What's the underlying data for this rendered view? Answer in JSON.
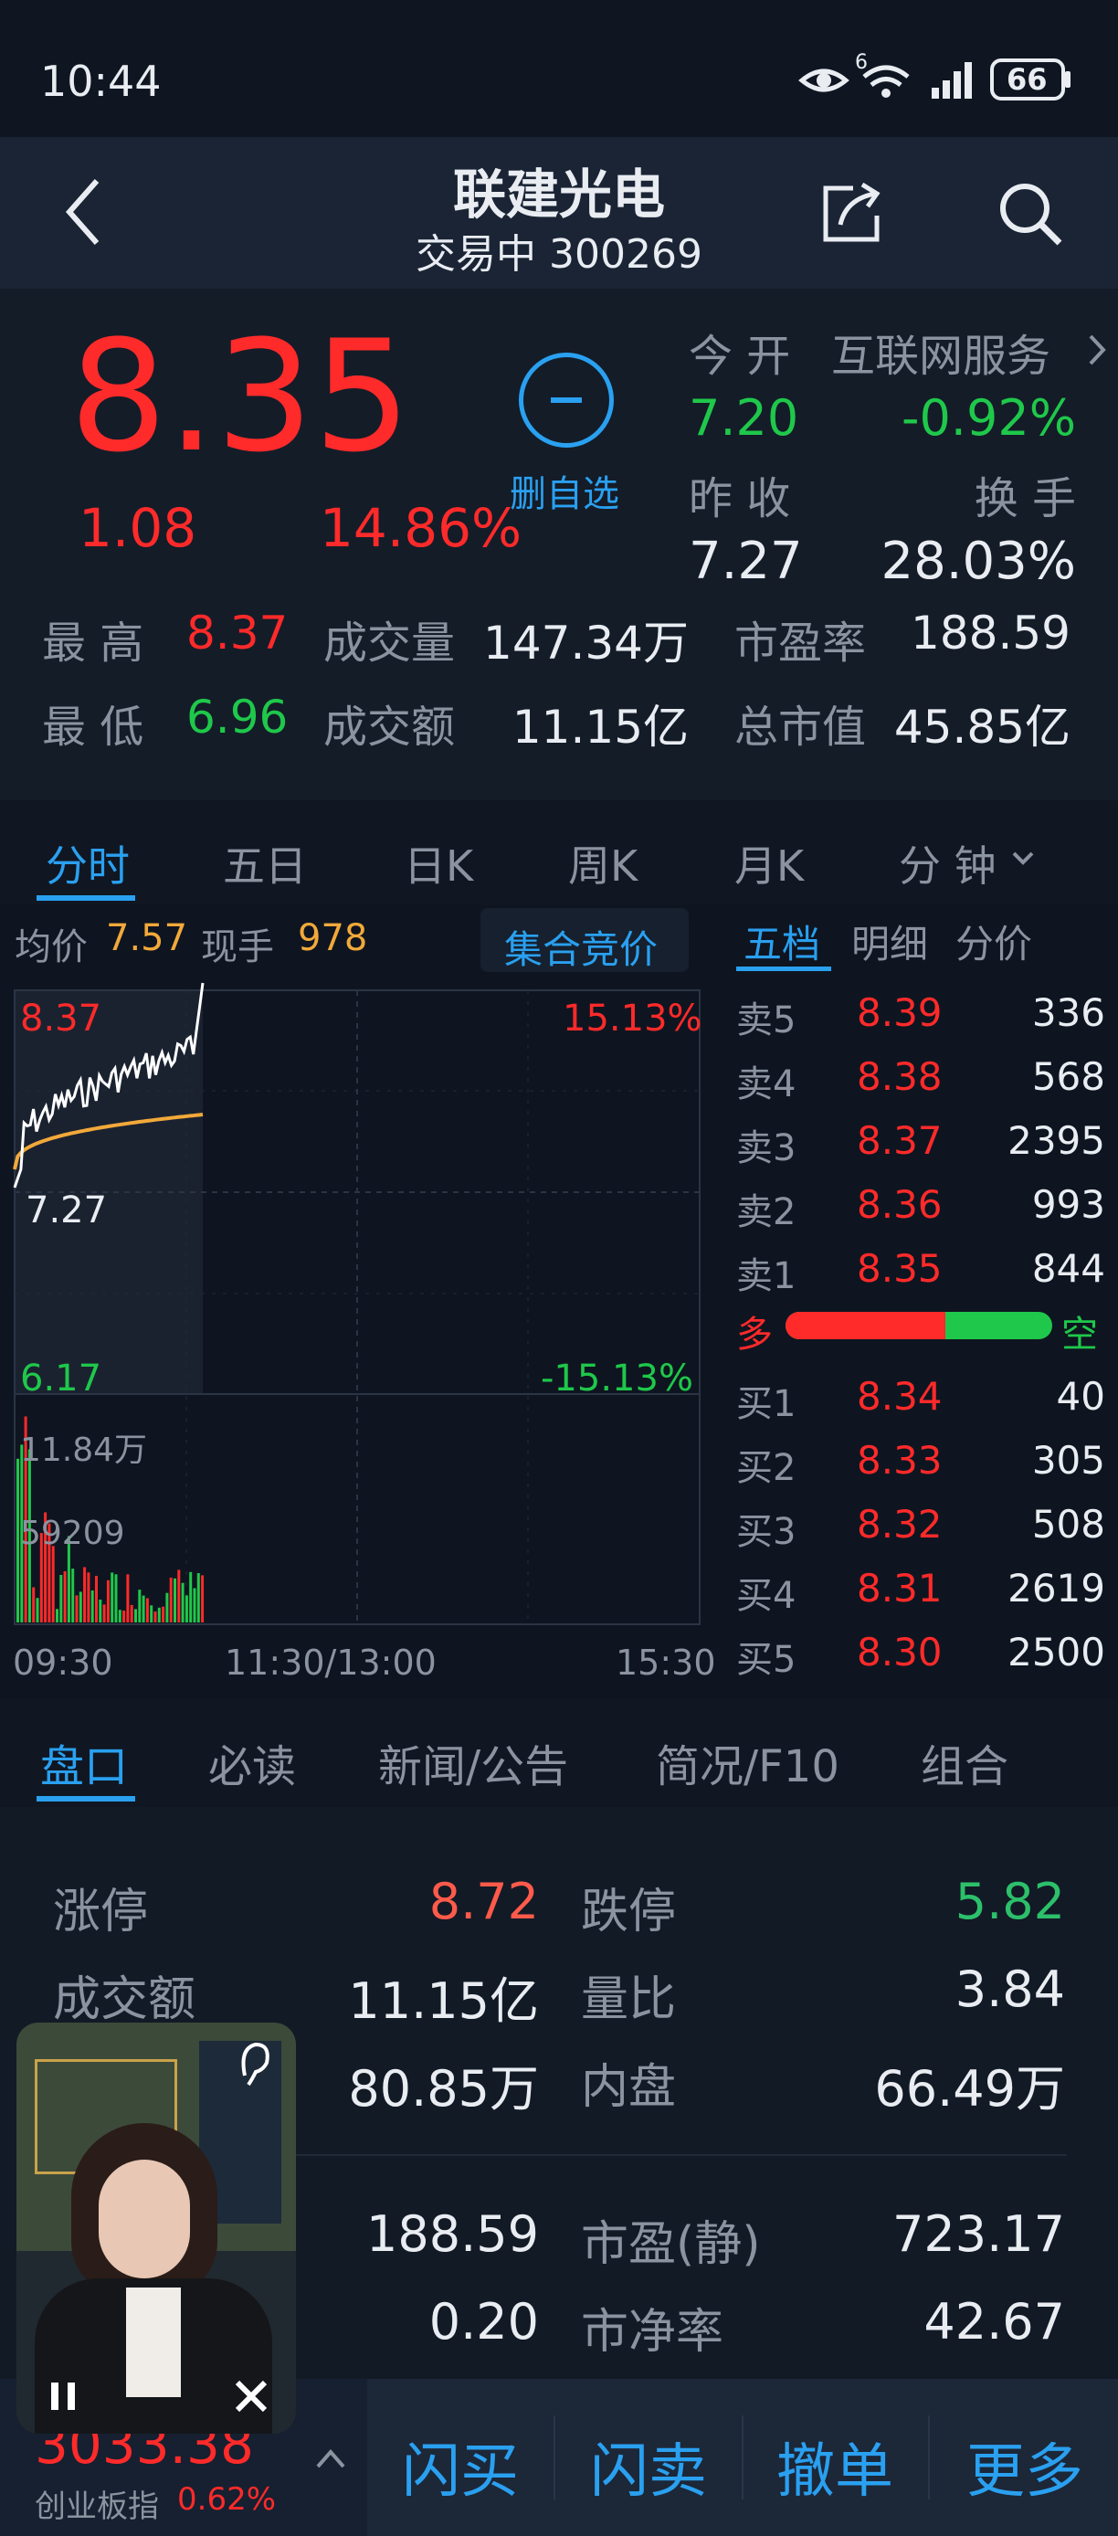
{
  "status": {
    "time": "10:44",
    "battery": "66",
    "network": "6"
  },
  "header": {
    "title": "联建光电",
    "subtitle": "交易中 300269"
  },
  "quote": {
    "price": "8.35",
    "change": "1.08",
    "change_pct": "14.86%",
    "watch_label": "删自选",
    "open_label": "今 开",
    "open": "7.20",
    "sector_label": "互联网服务",
    "sector_change": "-0.92%",
    "prev_close_label": "昨 收",
    "prev_close": "7.27",
    "turnover_label": "换 手",
    "turnover": "28.03%",
    "high_label": "最 高",
    "high": "8.37",
    "low_label": "最 低",
    "low": "6.96",
    "volume_label": "成交量",
    "volume": "147.34万",
    "amount_label": "成交额",
    "amount": "11.15亿",
    "pe_label": "市盈率",
    "pe": "188.59",
    "mcap_label": "总市值",
    "mcap": "45.85亿"
  },
  "period_tabs": [
    "分时",
    "五日",
    "日K",
    "周K",
    "月K",
    "分 钟"
  ],
  "chart_info": {
    "avg_label": "均价",
    "avg": "7.57",
    "cur_label": "现手",
    "cur": "978",
    "auction_btn": "集合竞价"
  },
  "chart_axis": {
    "top_price": "8.37",
    "mid_price": "7.27",
    "bot_price": "6.17",
    "top_pct": "15.13%",
    "bot_pct": "-15.13%",
    "vol_top": "11.84万",
    "vol_mid": "59209",
    "t_start": "09:30",
    "t_mid": "11:30/13:00",
    "t_end": "15:30"
  },
  "book_tabs": [
    "五档",
    "明细",
    "分价"
  ],
  "order_book": {
    "asks": [
      {
        "label": "卖5",
        "price": "8.39",
        "vol": "336"
      },
      {
        "label": "卖4",
        "price": "8.38",
        "vol": "568"
      },
      {
        "label": "卖3",
        "price": "8.37",
        "vol": "2395"
      },
      {
        "label": "卖2",
        "price": "8.36",
        "vol": "993"
      },
      {
        "label": "卖1",
        "price": "8.35",
        "vol": "844"
      }
    ],
    "bull_label": "多",
    "bear_label": "空",
    "bull_ratio": 0.6,
    "bids": [
      {
        "label": "买1",
        "price": "8.34",
        "vol": "40"
      },
      {
        "label": "买2",
        "price": "8.33",
        "vol": "305"
      },
      {
        "label": "买3",
        "price": "8.32",
        "vol": "508"
      },
      {
        "label": "买4",
        "price": "8.31",
        "vol": "2619"
      },
      {
        "label": "买5",
        "price": "8.30",
        "vol": "2500"
      }
    ]
  },
  "info_tabs": [
    "盘口",
    "必读",
    "新闻/公告",
    "简况/F10",
    "组合"
  ],
  "detail": {
    "limit_up_label": "涨停",
    "limit_up": "8.72",
    "limit_down_label": "跌停",
    "limit_down": "5.82",
    "amount_label": "成交额",
    "amount": "11.15亿",
    "vol_ratio_label": "量比",
    "vol_ratio": "3.84",
    "outer": "80.85万",
    "inner_label": "内盘",
    "inner": "66.49万",
    "pe_ttm": "188.59",
    "pe_static_label": "市盈(静)",
    "pe_static": "723.17",
    "eps": "0.20",
    "pb_label": "市净率",
    "pb": "42.67"
  },
  "bottom": {
    "index_value": "3033.38",
    "index_name": "创业板指",
    "index_pct": "0.62%",
    "buy": "闪买",
    "sell": "闪卖",
    "cancel": "撤单",
    "more": "更多"
  }
}
